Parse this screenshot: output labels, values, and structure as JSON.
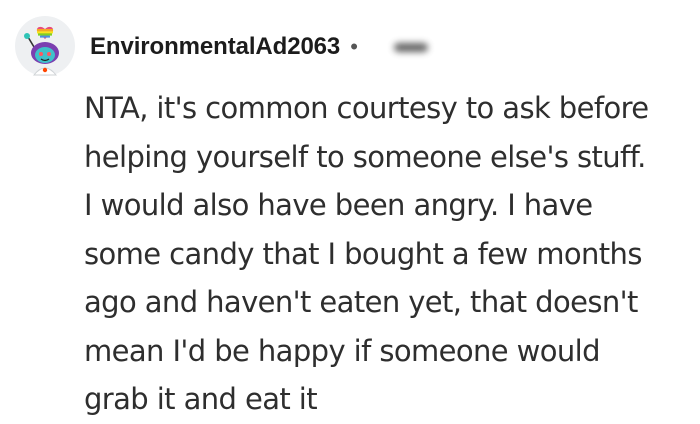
{
  "comment": {
    "author": {
      "username": "EnvironmentalAd2063",
      "separator": "•",
      "avatar_icon": "snoo-avatar-icon",
      "flair_icon": "rainbow-heart-icon"
    },
    "body_lines": [
      "NTA, it's common courtesy to ask before",
      "helping yourself to someone else's stuff.",
      "I would also have been angry. I have",
      "some candy that I bought a few months",
      "ago and haven't eaten yet, that doesn't",
      "mean I'd be happy if someone would",
      "grab it and eat it"
    ]
  }
}
